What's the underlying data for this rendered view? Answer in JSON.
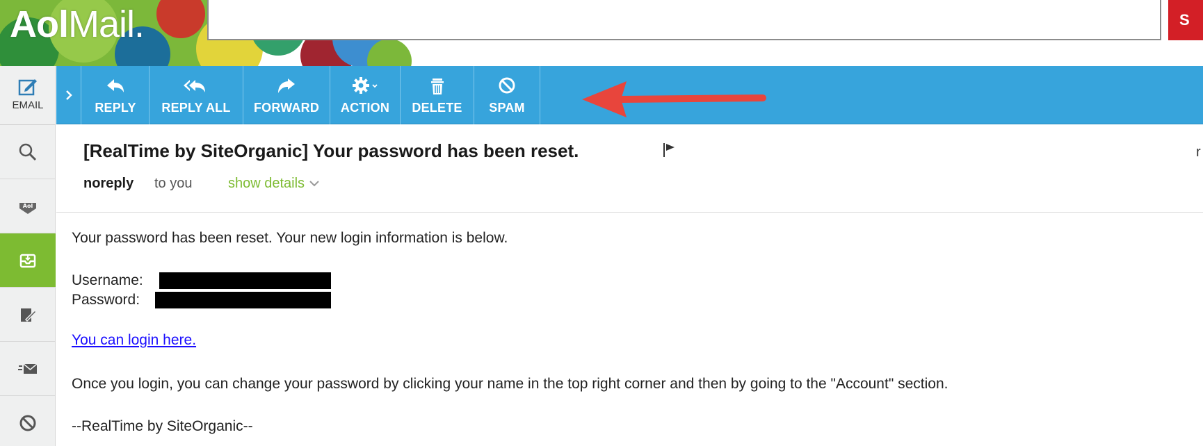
{
  "header": {
    "logo_brand": "Aol",
    "logo_product": "Mail.",
    "search_placeholder": "",
    "search_button_label": "S"
  },
  "rail": {
    "compose_label": "EMAIL",
    "items": [
      "search-icon",
      "aol-icon",
      "inbox-icon",
      "drafts-icon",
      "sent-icon",
      "spam-icon"
    ]
  },
  "toolbar": {
    "buttons": [
      {
        "label": "REPLY",
        "icon": "reply-icon"
      },
      {
        "label": "REPLY ALL",
        "icon": "reply-all-icon"
      },
      {
        "label": "FORWARD",
        "icon": "forward-icon"
      },
      {
        "label": "ACTION",
        "icon": "gear-icon"
      },
      {
        "label": "DELETE",
        "icon": "trash-icon"
      },
      {
        "label": "SPAM",
        "icon": "spam-icon"
      }
    ]
  },
  "message": {
    "subject": "[RealTime by SiteOrganic] Your password has been reset.",
    "sender": "noreply",
    "recipient": "to you",
    "details_link": "show details",
    "cut_letter": "r",
    "body": {
      "intro": "Your password has been reset. Your new login information is below.",
      "username_label": "Username:",
      "password_label": "Password:",
      "login_link": "You can login here.",
      "instructions": "Once you login, you can change your password by clicking your name in the top right corner and then by going to the \"Account\" section.",
      "signature": "--RealTime by SiteOrganic--"
    }
  },
  "colors": {
    "toolbar_blue": "#37a4dc",
    "active_green": "#7dbb32",
    "search_red": "#d31f26",
    "annotation_arrow": "#e8453c",
    "link_blue": "#1a0dff"
  }
}
